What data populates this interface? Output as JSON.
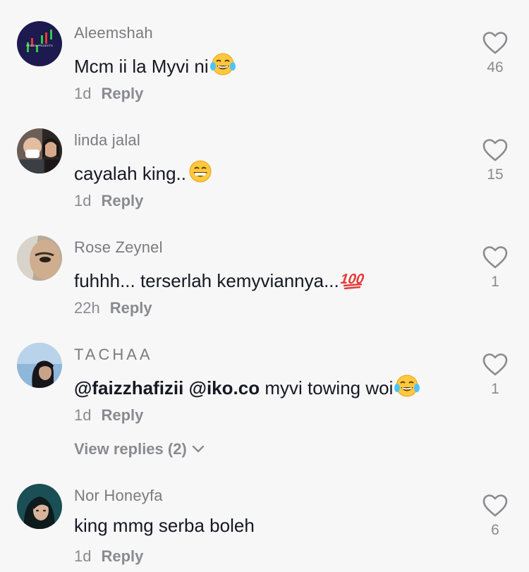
{
  "comments": [
    {
      "username": "Aleemshah",
      "text": "Mcm ii la Myvi ni",
      "emoji": "tears-of-joy",
      "time": "1d",
      "reply_label": "Reply",
      "likes": "46",
      "avatar_text": "PRICEN PROJECTS"
    },
    {
      "username": "linda jalal",
      "text": "cayalah king..",
      "emoji": "grinning",
      "time": "1d",
      "reply_label": "Reply",
      "likes": "15"
    },
    {
      "username": "Rose Zeynel",
      "text": "fuhhh... terserlah kemyviannya... ",
      "emoji": "hundred",
      "time": "22h",
      "reply_label": "Reply",
      "likes": "1"
    },
    {
      "username": "TACHAA",
      "mentions": [
        "@faizzhafizii",
        "@iko.co"
      ],
      "text": " myvi towing woi",
      "emoji": "tears-of-joy",
      "time": "1d",
      "reply_label": "Reply",
      "likes": "1",
      "view_replies": "View replies (2)"
    },
    {
      "username": "Nor Honeyfa",
      "text": "king mmg serba boleh",
      "time": "1d",
      "reply_label": "Reply",
      "likes": "6"
    }
  ],
  "colors": {
    "background": "#f7f7f7",
    "text": "#161823",
    "secondary": "#8a8b91"
  }
}
